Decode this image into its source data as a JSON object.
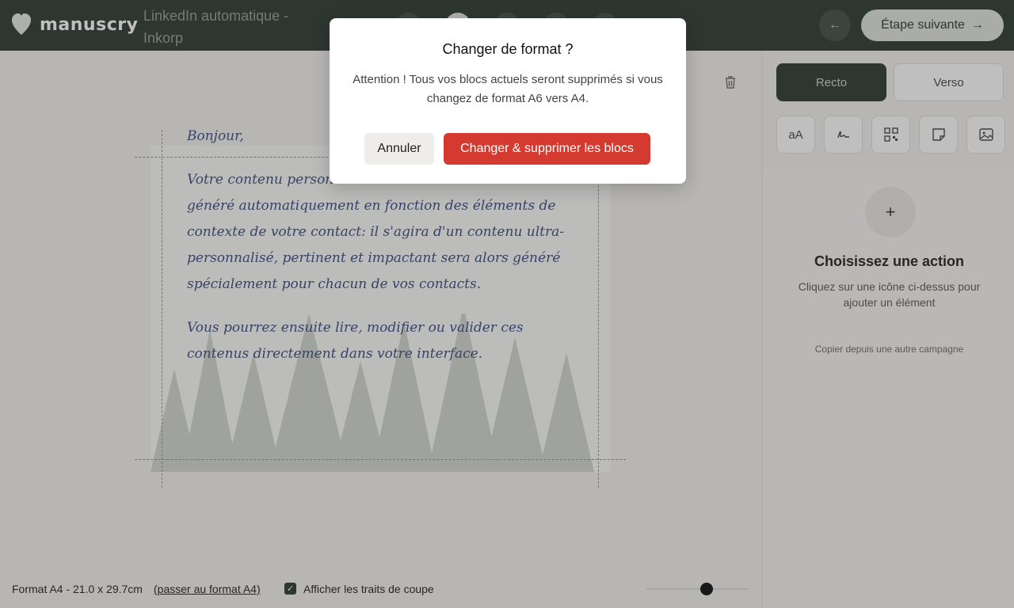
{
  "header": {
    "logo_text": "manuscry",
    "campaign_title": "LinkedIn automatique - Inkorp",
    "back_icon": "arrow-left-icon",
    "next_label": "Étape suivante",
    "next_icon": "arrow-right-icon"
  },
  "card": {
    "greeting": "Bonjour,",
    "body": "Votre contenu personnalisé sera écrit ici... Il va être généré automatiquement en fonction des éléments de contexte de votre contact: il s'agira d'un contenu ultra-personnalisé, pertinent et impactant sera alors généré spécialement pour chacun de vos contacts.",
    "body2": "Vous pourrez ensuite lire, modifier ou valider ces contenus directement dans votre interface."
  },
  "footer": {
    "format_text": "Format A4 - 21.0 x 29.7cm",
    "format_link": "(passer au format A4)",
    "checkbox_label": "Afficher les traits de coupe",
    "checkbox_checked": true
  },
  "panel": {
    "tab_recto": "Recto",
    "tab_verso": "Verso",
    "tools": [
      "text-icon",
      "signature-icon",
      "qrcode-icon",
      "sticky-note-icon",
      "image-icon"
    ],
    "tool_text_label": "aA",
    "plus_label": "+",
    "action_title": "Choisissez une action",
    "action_desc": "Cliquez sur une icône ci-dessus pour ajouter un élément",
    "copy_link": "Copier depuis une autre campagne"
  },
  "modal": {
    "title": "Changer de format ?",
    "text": "Attention ! Tous vos blocs actuels seront supprimés si vous changez de format A6 vers A4.",
    "cancel_label": "Annuler",
    "confirm_label": "Changer & supprimer les blocs"
  },
  "colors": {
    "header_bg": "#3c4a41",
    "danger": "#d43a2f",
    "ink": "#4a5a8a"
  }
}
